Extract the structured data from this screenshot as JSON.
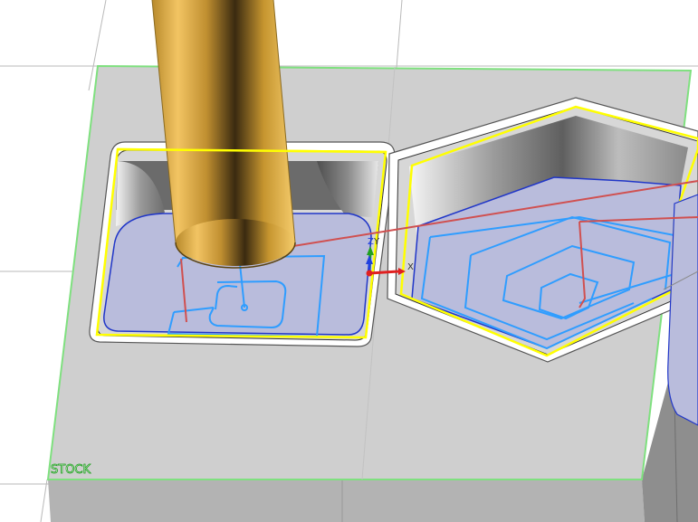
{
  "viewport": {
    "stock_label": "STOCK",
    "triad_labels": {
      "z": "Z",
      "y": "Y",
      "x": "X"
    },
    "colors": {
      "background": "#ffffff",
      "grid": "#b9b9b9",
      "stock_top": "#cfcfcf",
      "stock_side": "#b0b0b0",
      "stock_outline": "#7fe07f",
      "boundary": "#ffff00",
      "toolpath": "#2f9dff",
      "rapid": "#d05050",
      "pocket_floor": "#b8bcdc",
      "tool": "#e8b44a",
      "axis_x": "#e02020",
      "axis_y": "#20a020",
      "axis_z": "#2040e0"
    }
  }
}
